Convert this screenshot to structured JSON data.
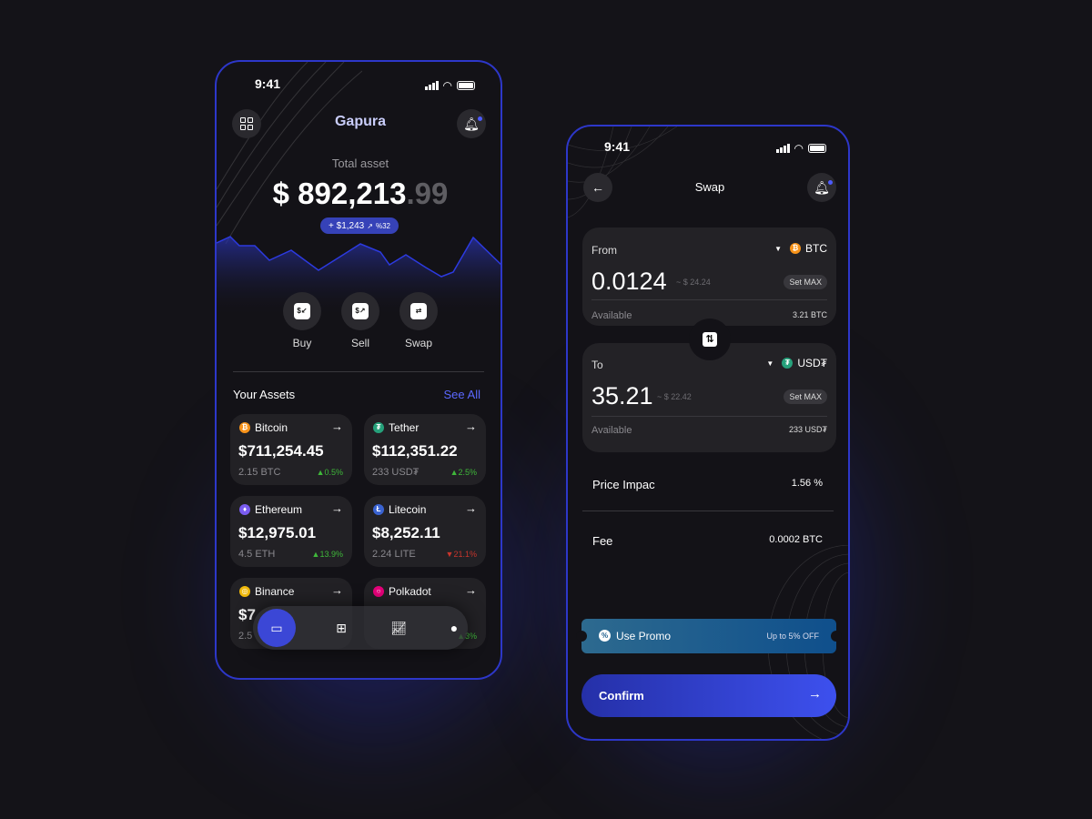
{
  "colors": {
    "accent": "#3b47d6",
    "up": "#3fb83a",
    "down": "#c8352c",
    "btc": "#f7931a",
    "usdt": "#26a17b",
    "eth": "#7a5cf0",
    "ltc": "#3a63d1",
    "bnb": "#f0b90b",
    "dot": "#e6007a"
  },
  "home": {
    "status_time": "9:41",
    "title": "Gapura",
    "total_label": "Total asset",
    "total_main": "$ 892,213",
    "total_cents": ".99",
    "change_amount": "+ $1,243",
    "change_pct": "%32",
    "actions": [
      {
        "label": "Buy",
        "icon": "buy-icon"
      },
      {
        "label": "Sell",
        "icon": "sell-icon"
      },
      {
        "label": "Swap",
        "icon": "swap-icon"
      }
    ],
    "assets_title": "Your Assets",
    "see_all": "See All",
    "assets": [
      {
        "name": "Bitcoin",
        "value": "$711,254.45",
        "amount": "2.15 BTC",
        "change": "0.5%",
        "direction": "up",
        "icon": "bitcoin-icon"
      },
      {
        "name": "Tether",
        "value": "$112,351.22",
        "amount": "233 USD₮",
        "change": "2.5%",
        "direction": "up",
        "icon": "tether-icon"
      },
      {
        "name": "Ethereum",
        "value": "$12,975.01",
        "amount": "4.5 ETH",
        "change": "13.9%",
        "direction": "up",
        "icon": "ethereum-icon"
      },
      {
        "name": "Litecoin",
        "value": "$8,252.11",
        "amount": "2.24 LITE",
        "change": "21.1%",
        "direction": "down",
        "icon": "litecoin-icon"
      },
      {
        "name": "Binance",
        "value": "$7",
        "amount": "2.5",
        "change": "",
        "direction": "up",
        "icon": "binance-icon"
      },
      {
        "name": "Polkadot",
        "value": "",
        "amount": "",
        "change": "3%",
        "direction": "up",
        "icon": "polkadot-icon"
      }
    ],
    "nav": [
      "wallet-icon",
      "add-card-icon",
      "chart-icon",
      "profile-icon"
    ]
  },
  "swap": {
    "status_time": "9:41",
    "title": "Swap",
    "from": {
      "label": "From",
      "token": "BTC",
      "amount": "0.0124",
      "usd": "~ $ 24.24",
      "set_max": "Set MAX",
      "available_label": "Available",
      "available": "3.21 BTC"
    },
    "to": {
      "label": "To",
      "token": "USD₮",
      "amount": "35.21",
      "usd": "~ $ 22.42",
      "set_max": "Set MAX",
      "available_label": "Available",
      "available": "233 USD₮"
    },
    "price_impact_label": "Price Impac",
    "price_impact": "1.56 %",
    "fee_label": "Fee",
    "fee": "0.0002 BTC",
    "promo_label": "Use Promo",
    "promo_offer": "Up to 5% OFF",
    "confirm": "Confirm"
  }
}
